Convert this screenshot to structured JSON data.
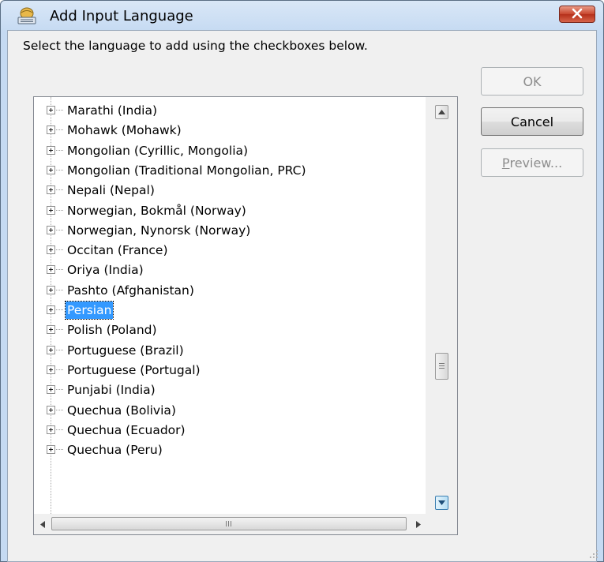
{
  "window": {
    "title": "Add Input Language",
    "icon": "keyboard-globe-icon",
    "close_icon": "close-x-icon"
  },
  "instruction": "Select the language to add using the checkboxes below.",
  "buttons": {
    "ok": "OK",
    "cancel": "Cancel",
    "preview_mnemonic": "P",
    "preview_rest": "review..."
  },
  "tree": {
    "items": [
      {
        "label": "Marathi (India)",
        "selected": false
      },
      {
        "label": "Mohawk (Mohawk)",
        "selected": false
      },
      {
        "label": "Mongolian (Cyrillic, Mongolia)",
        "selected": false
      },
      {
        "label": "Mongolian (Traditional Mongolian, PRC)",
        "selected": false
      },
      {
        "label": "Nepali (Nepal)",
        "selected": false
      },
      {
        "label": "Norwegian, Bokmål (Norway)",
        "selected": false
      },
      {
        "label": "Norwegian, Nynorsk (Norway)",
        "selected": false
      },
      {
        "label": "Occitan (France)",
        "selected": false
      },
      {
        "label": "Oriya (India)",
        "selected": false
      },
      {
        "label": "Pashto (Afghanistan)",
        "selected": false
      },
      {
        "label": "Persian",
        "selected": true
      },
      {
        "label": "Polish (Poland)",
        "selected": false
      },
      {
        "label": "Portuguese (Brazil)",
        "selected": false
      },
      {
        "label": "Portuguese (Portugal)",
        "selected": false
      },
      {
        "label": "Punjabi (India)",
        "selected": false
      },
      {
        "label": "Quechua (Bolivia)",
        "selected": false
      },
      {
        "label": "Quechua (Ecuador)",
        "selected": false
      },
      {
        "label": "Quechua (Peru)",
        "selected": false
      }
    ]
  },
  "scrollbars": {
    "hscroll_grip": "III"
  },
  "colors": {
    "selection": "#3399ff",
    "close_button": "#c7452d",
    "titlebar": "#c5daf2"
  }
}
